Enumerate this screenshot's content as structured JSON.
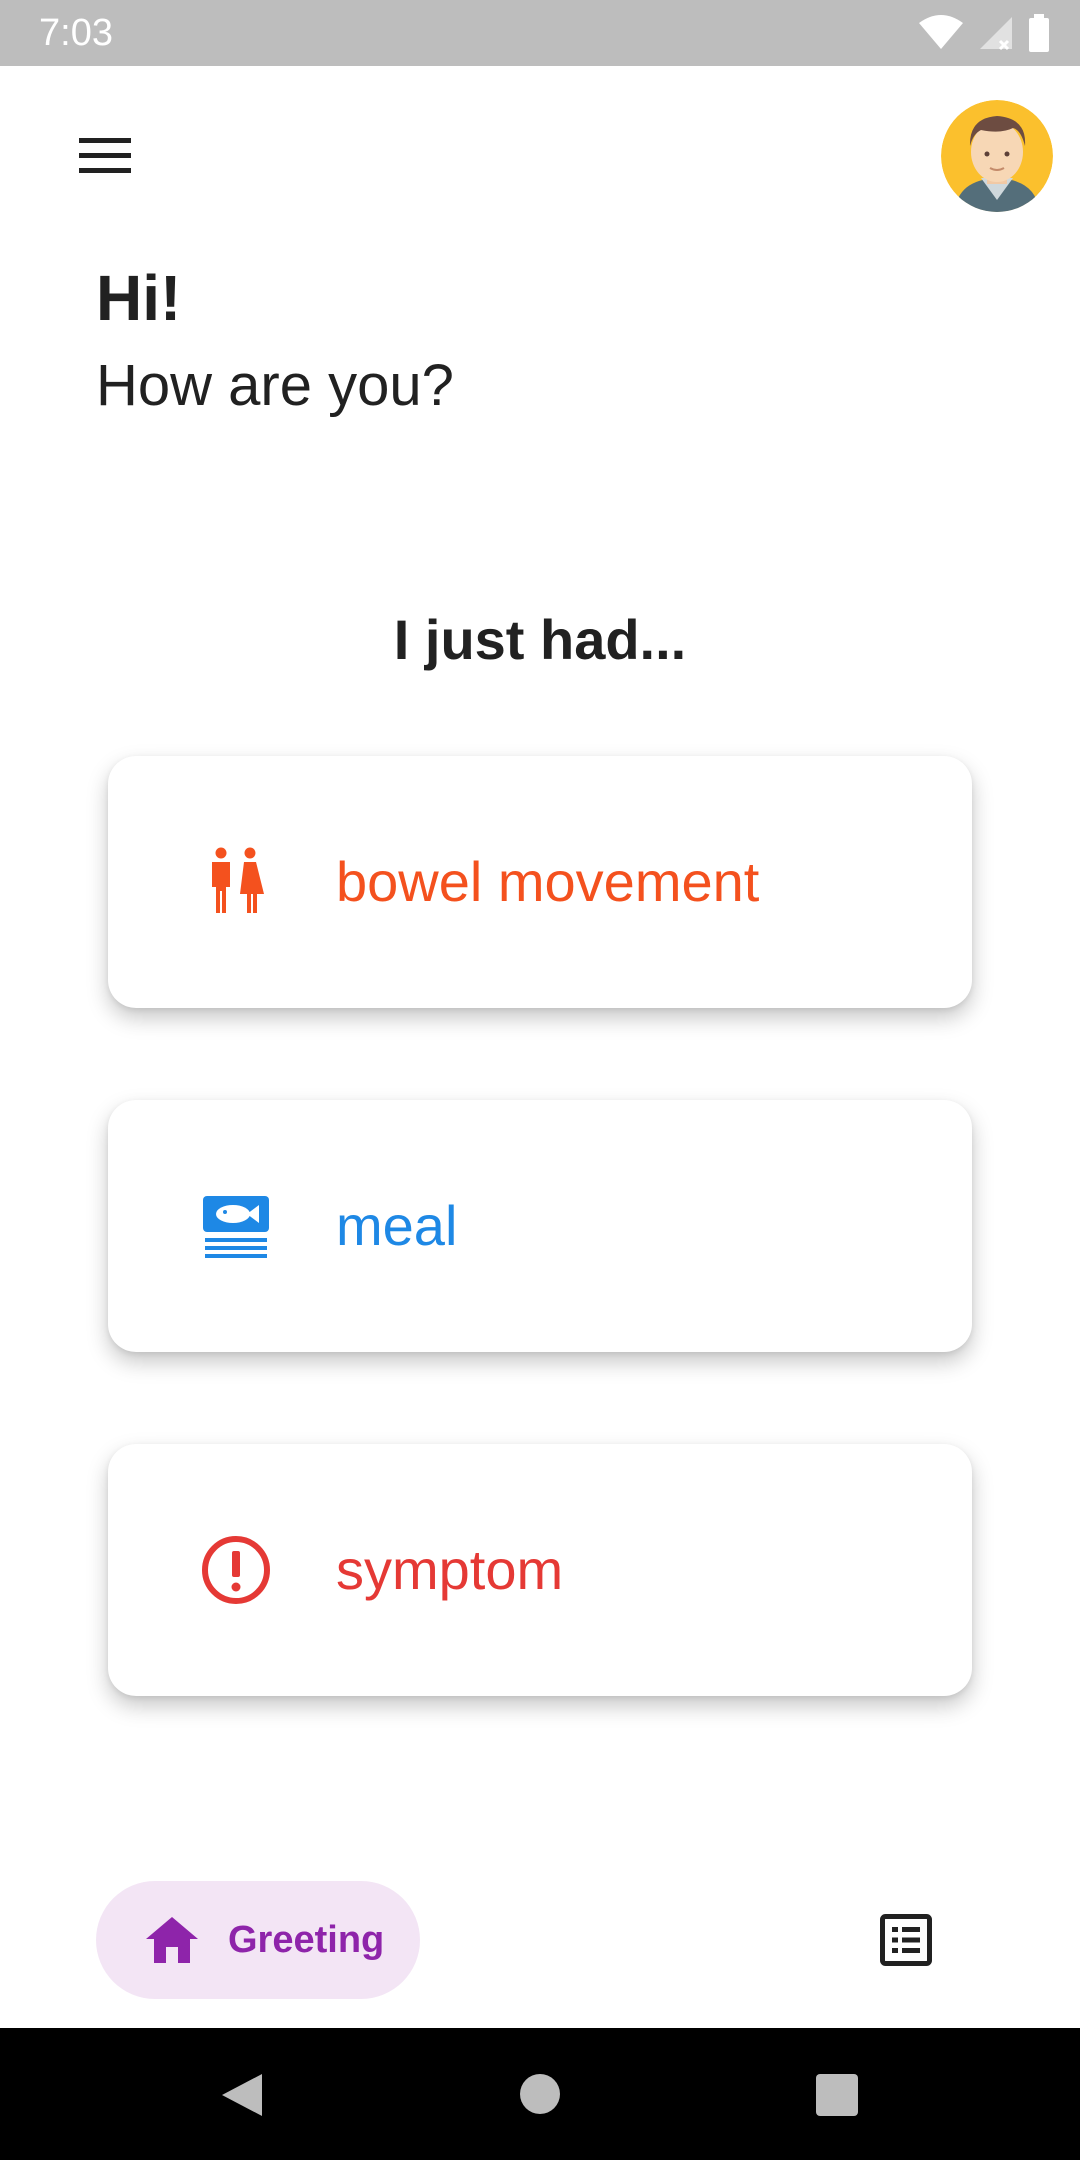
{
  "status_bar": {
    "time": "7:03",
    "icons": [
      "wifi-icon",
      "cell-signal-icon",
      "battery-icon"
    ]
  },
  "header": {
    "menu_icon": "hamburger-menu-icon",
    "avatar_icon": "user-avatar"
  },
  "greeting": {
    "title": "Hi!",
    "subtitle": "How are you?"
  },
  "prompt": {
    "heading": "I just had..."
  },
  "cards": [
    {
      "label": "bowel movement",
      "icon": "restroom-icon",
      "color": "#f4511e"
    },
    {
      "label": "meal",
      "icon": "meal-fish-icon",
      "color": "#1e88e5"
    },
    {
      "label": "symptom",
      "icon": "alert-circle-icon",
      "color": "#e53935"
    }
  ],
  "bottom_nav": {
    "home": {
      "label": "Greeting",
      "icon": "home-icon",
      "color": "#8e24aa",
      "bg": "#f3e5f5"
    },
    "list": {
      "icon": "list-icon"
    }
  },
  "system_nav": {
    "buttons": [
      "back-icon",
      "home-circle-icon",
      "recents-square-icon"
    ]
  }
}
